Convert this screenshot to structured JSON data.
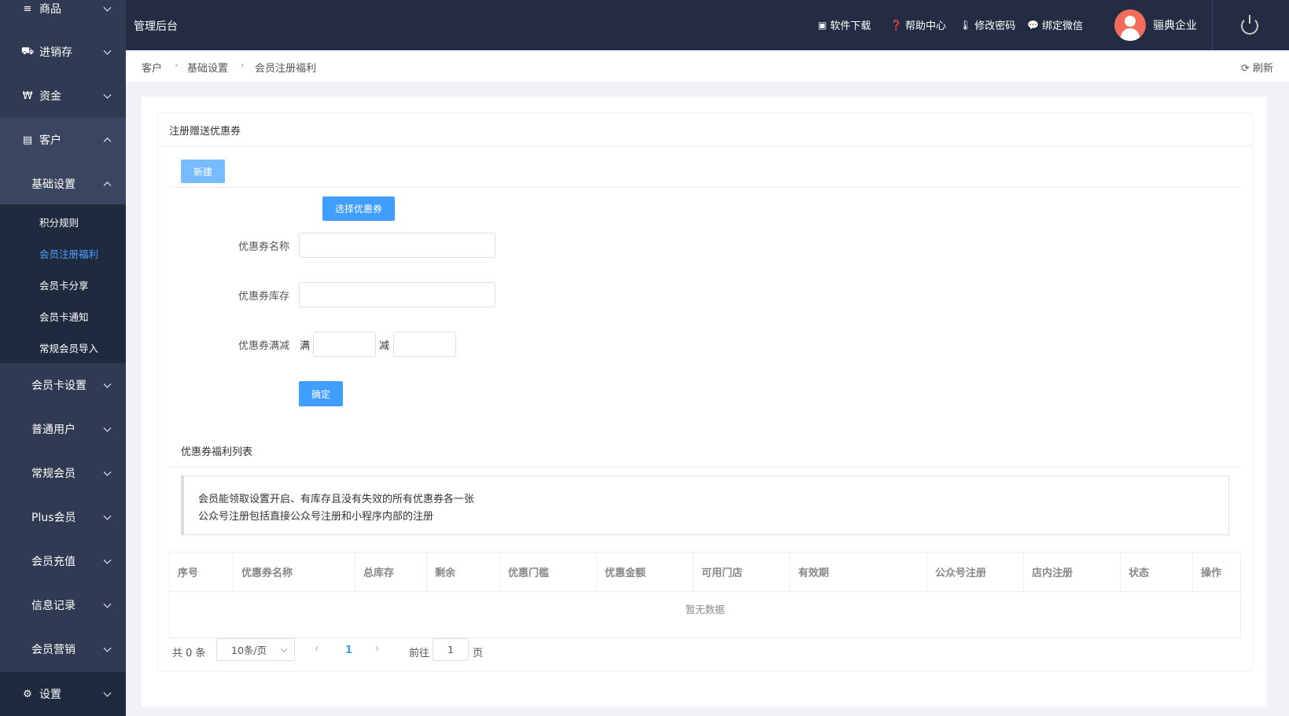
{
  "sidebar": {
    "items": [
      {
        "label": "商品",
        "icon": "menu-icon"
      },
      {
        "label": "进销存",
        "icon": "truck-icon"
      },
      {
        "label": "资金",
        "icon": "won-icon"
      },
      {
        "label": "客户",
        "icon": "id-card-icon"
      },
      {
        "label": "基础设置"
      },
      {
        "label": "会员卡设置"
      },
      {
        "label": "普通用户"
      },
      {
        "label": "常规会员"
      },
      {
        "label": "Plus会员"
      },
      {
        "label": "会员充值"
      },
      {
        "label": "信息记录"
      },
      {
        "label": "会员营销"
      },
      {
        "label": "设置",
        "icon": "gear-icon"
      }
    ],
    "sub_links": [
      "积分规则",
      "会员注册福利",
      "会员卡分享",
      "会员卡通知",
      "常规会员导入"
    ]
  },
  "header": {
    "brand": "管理后台",
    "nav": [
      "软件下载",
      "帮助中心",
      "修改密码",
      "绑定微信"
    ],
    "company": "骊典企业"
  },
  "breadcrumb": {
    "items": [
      "客户",
      "基础设置",
      "会员注册福利"
    ],
    "refresh": "刷新"
  },
  "form": {
    "section_title": "注册赠送优惠券",
    "new_button": "新建",
    "select_coupon_button": "选择优惠券",
    "name_label": "优惠券名称",
    "stock_label": "优惠券库存",
    "threshold_label": "优惠券满减",
    "full_label": "满",
    "minus_label": "减",
    "confirm_button": "确定"
  },
  "list": {
    "title": "优惠券福利列表",
    "notice_line1": "会员能领取设置开启、有库存且没有失效的所有优惠券各一张",
    "notice_line2": "公众号注册包括直接公众号注册和小程序内部的注册",
    "columns": [
      "序号",
      "优惠券名称",
      "总库存",
      "剩余",
      "优惠门槛",
      "优惠金额",
      "可用门店",
      "有效期",
      "公众号注册",
      "店内注册",
      "状态",
      "操作"
    ],
    "empty": "暂无数据"
  },
  "pagination": {
    "total": "共 0 条",
    "page_size": "10条/页",
    "current_page": "1",
    "goto_label": "前往",
    "goto_value": "1",
    "page_suffix": "页"
  }
}
